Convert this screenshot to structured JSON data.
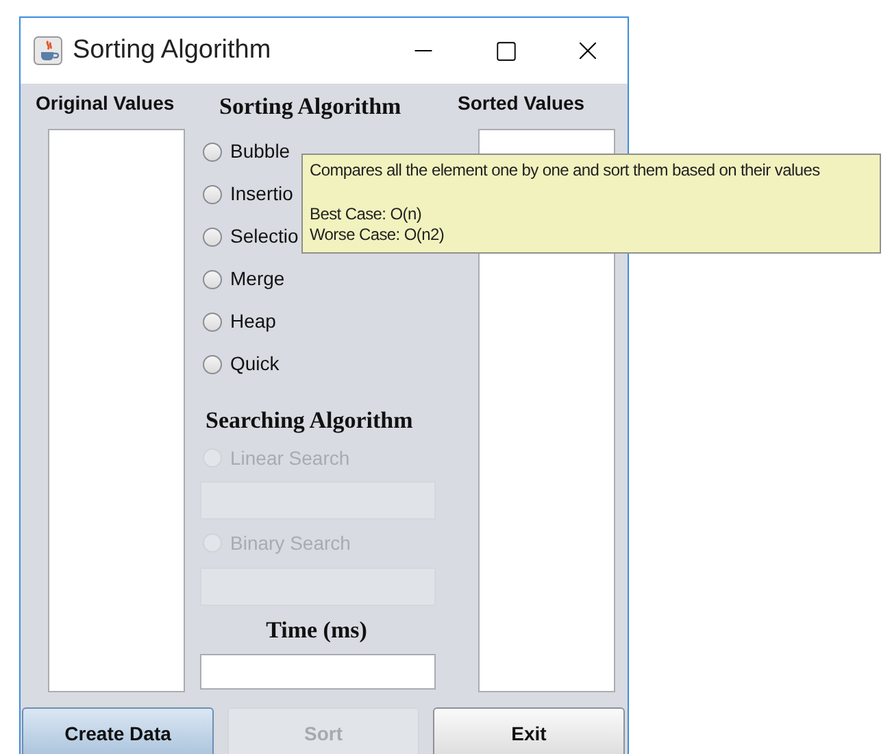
{
  "window": {
    "title": "Sorting Algorithm"
  },
  "original_values": {
    "label": "Original Values"
  },
  "sorting": {
    "heading": "Sorting Algorithm",
    "options": [
      {
        "label": "Bubble",
        "selected": false
      },
      {
        "label": "Insertio",
        "selected": false
      },
      {
        "label": "Selectio",
        "selected": false
      },
      {
        "label": "Merge",
        "selected": false
      },
      {
        "label": "Heap",
        "selected": false
      },
      {
        "label": "Quick",
        "selected": false
      }
    ]
  },
  "searching": {
    "heading": "Searching Algorithm",
    "options": [
      {
        "label": "Linear Search",
        "selected": false,
        "disabled": true
      },
      {
        "label": "Binary Search",
        "selected": false,
        "disabled": true
      }
    ]
  },
  "time": {
    "heading": "Time (ms)"
  },
  "sorted_values": {
    "label": "Sorted Values"
  },
  "buttons": [
    {
      "label": "Create Data",
      "focused": true,
      "disabled": false
    },
    {
      "label": "Sort",
      "focused": false,
      "disabled": true
    },
    {
      "label": "Exit",
      "focused": false,
      "disabled": false
    }
  ],
  "tooltip": {
    "lines": [
      "Compares all the element one by one and sort them based on their values",
      "Best Case: O(n)",
      "Worse Case: O(n2)"
    ]
  }
}
